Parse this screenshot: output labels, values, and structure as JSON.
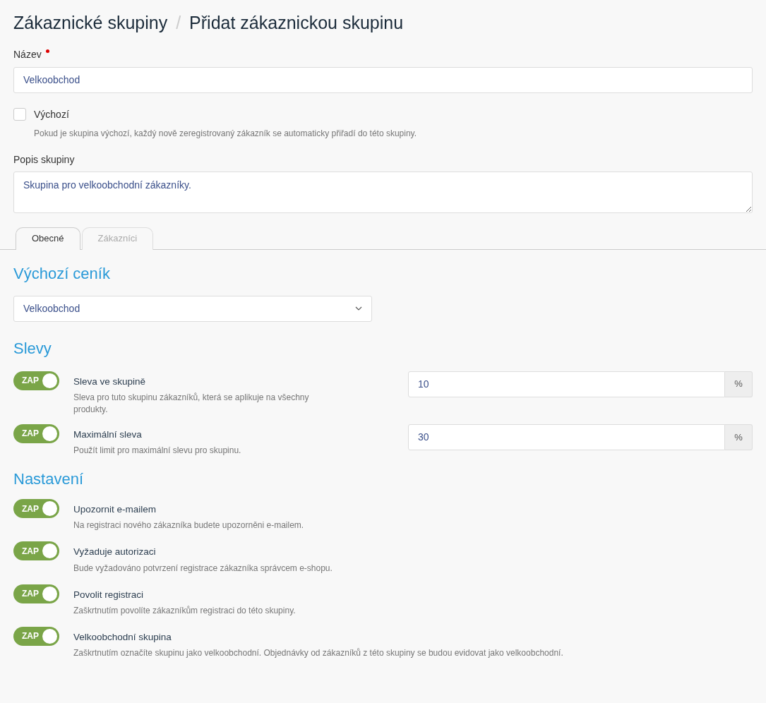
{
  "breadcrumb": {
    "parent": "Zákaznické skupiny",
    "separator": "/",
    "current": "Přidat zákaznickou skupinu"
  },
  "name_field": {
    "label": "Název",
    "required": true,
    "value": "Velkoobchod"
  },
  "default_checkbox": {
    "label": "Výchozí",
    "checked": false,
    "help": "Pokud je skupina výchozí, každý nově zeregistrovaný zákazník se automaticky přiřadí do této skupiny."
  },
  "description_field": {
    "label": "Popis skupiny",
    "value": "Skupina pro velkoobchodní zákazníky."
  },
  "tabs": [
    {
      "label": "Obecné",
      "selected": true
    },
    {
      "label": "Zákazníci",
      "selected": false
    }
  ],
  "price_list": {
    "heading": "Výchozí ceník",
    "value": "Velkoobchod"
  },
  "discounts": {
    "heading": "Slevy",
    "items": [
      {
        "toggle_label": "ZAP",
        "on": true,
        "title": "Sleva ve skupině",
        "help": "Sleva pro tuto skupinu zákazníků, která se aplikuje na všechny produkty.",
        "value": "10",
        "unit": "%"
      },
      {
        "toggle_label": "ZAP",
        "on": true,
        "title": "Maximální sleva",
        "help": "Použít limit pro maximální slevu pro skupinu.",
        "value": "30",
        "unit": "%"
      }
    ]
  },
  "settings": {
    "heading": "Nastavení",
    "items": [
      {
        "toggle_label": "ZAP",
        "on": true,
        "title": "Upozornit e-mailem",
        "help": "Na registraci nového zákazníka budete upozorněni e-mailem."
      },
      {
        "toggle_label": "ZAP",
        "on": true,
        "title": "Vyžaduje autorizaci",
        "help": "Bude vyžadováno potvrzení registrace zákazníka správcem e-shopu."
      },
      {
        "toggle_label": "ZAP",
        "on": true,
        "title": "Povolit registraci",
        "help": "Zaškrtnutím povolíte zákazníkům registraci do této skupiny."
      },
      {
        "toggle_label": "ZAP",
        "on": true,
        "title": "Velkoobchodní skupina",
        "help": "Zaškrtnutím označíte skupinu jako velkoobchodní. Objednávky od zákazníků z této skupiny se budou evidovat jako velkoobchodní."
      }
    ]
  }
}
